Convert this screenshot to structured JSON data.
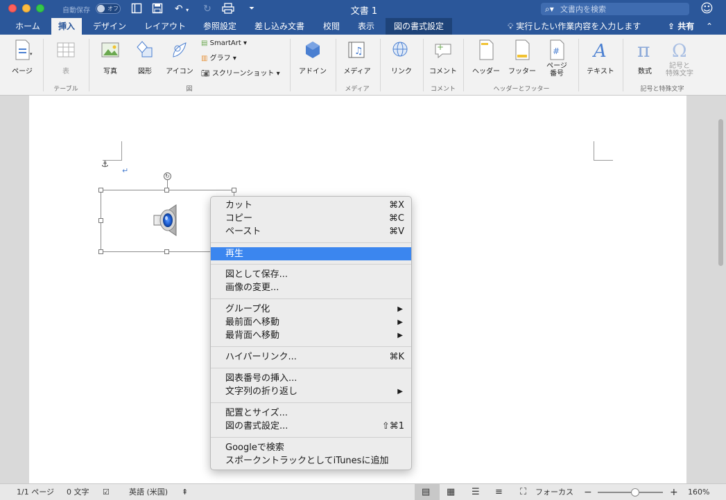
{
  "titlebar": {
    "autosave_label": "自動保存",
    "autosave_state": "オフ",
    "doc_title": "文書 1",
    "search_placeholder": "文書内を検索"
  },
  "tabs": [
    {
      "label": "ホーム"
    },
    {
      "label": "挿入"
    },
    {
      "label": "デザイン"
    },
    {
      "label": "レイアウト"
    },
    {
      "label": "参照設定"
    },
    {
      "label": "差し込み文書"
    },
    {
      "label": "校閲"
    },
    {
      "label": "表示"
    },
    {
      "label": "図の書式設定"
    }
  ],
  "tell_me": "実行したい作業内容を入力します",
  "share_label": "共有",
  "ribbon": {
    "page": "ページ",
    "table": "表",
    "photo": "写真",
    "shapes": "図形",
    "icons": "アイコン",
    "smartart": "SmartArt",
    "graph": "グラフ",
    "screenshot": "スクリーンショット",
    "addins": "アドイン",
    "media": "メディア",
    "link": "リンク",
    "comment": "コメント",
    "header": "ヘッダー",
    "footer": "フッター",
    "page_number_1": "ページ",
    "page_number_2": "番号",
    "text": "テキスト",
    "equation": "数式",
    "symbol_1": "記号と",
    "symbol_2": "特殊文字",
    "groups": {
      "table": "テーブル",
      "illustrations": "図",
      "media": "メディア",
      "comment": "コメント",
      "header_footer": "ヘッダーとフッター",
      "symbols": "記号と特殊文字"
    }
  },
  "context_menu": {
    "cut": {
      "label": "カット",
      "shortcut": "⌘X"
    },
    "copy": {
      "label": "コピー",
      "shortcut": "⌘C"
    },
    "paste": {
      "label": "ペースト",
      "shortcut": "⌘V"
    },
    "play": {
      "label": "再生"
    },
    "save_as_picture": {
      "label": "図として保存..."
    },
    "change_picture": {
      "label": "画像の変更..."
    },
    "group": {
      "label": "グループ化"
    },
    "bring_to_front": {
      "label": "最前面へ移動"
    },
    "send_to_back": {
      "label": "最背面へ移動"
    },
    "hyperlink": {
      "label": "ハイパーリンク...",
      "shortcut": "⌘K"
    },
    "insert_caption": {
      "label": "図表番号の挿入..."
    },
    "wrap_text": {
      "label": "文字列の折り返し"
    },
    "size_position": {
      "label": "配置とサイズ..."
    },
    "format_picture": {
      "label": "図の書式設定...",
      "shortcut": "⇧⌘1"
    },
    "google_search": {
      "label": "Googleで検索"
    },
    "itunes": {
      "label": "スポークントラックとしてiTunesに追加"
    }
  },
  "statusbar": {
    "page": "1/1 ページ",
    "words": "0 文字",
    "language": "英語 (米国)",
    "focus": "フォーカス",
    "zoom": "160%"
  },
  "colors": {
    "brand": "#2b579a",
    "highlight": "#3b86ef"
  }
}
